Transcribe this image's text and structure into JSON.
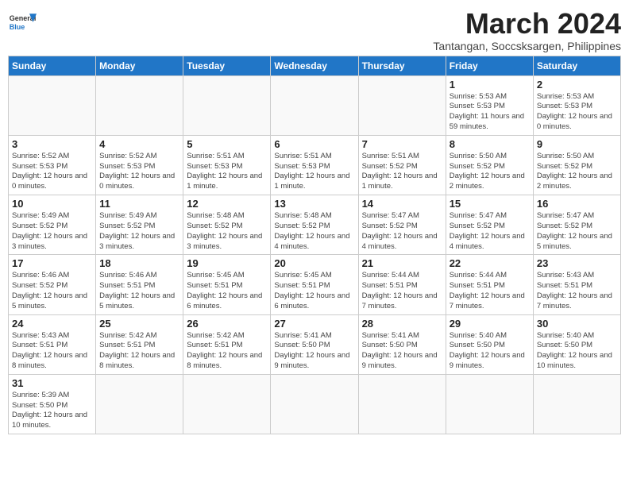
{
  "logo": {
    "general": "General",
    "blue": "Blue"
  },
  "title": "March 2024",
  "subtitle": "Tantangan, Soccsksargen, Philippines",
  "days_of_week": [
    "Sunday",
    "Monday",
    "Tuesday",
    "Wednesday",
    "Thursday",
    "Friday",
    "Saturday"
  ],
  "weeks": [
    [
      {
        "day": "",
        "info": ""
      },
      {
        "day": "",
        "info": ""
      },
      {
        "day": "",
        "info": ""
      },
      {
        "day": "",
        "info": ""
      },
      {
        "day": "",
        "info": ""
      },
      {
        "day": "1",
        "info": "Sunrise: 5:53 AM\nSunset: 5:53 PM\nDaylight: 11 hours and 59 minutes."
      },
      {
        "day": "2",
        "info": "Sunrise: 5:53 AM\nSunset: 5:53 PM\nDaylight: 12 hours and 0 minutes."
      }
    ],
    [
      {
        "day": "3",
        "info": "Sunrise: 5:52 AM\nSunset: 5:53 PM\nDaylight: 12 hours and 0 minutes."
      },
      {
        "day": "4",
        "info": "Sunrise: 5:52 AM\nSunset: 5:53 PM\nDaylight: 12 hours and 0 minutes."
      },
      {
        "day": "5",
        "info": "Sunrise: 5:51 AM\nSunset: 5:53 PM\nDaylight: 12 hours and 1 minute."
      },
      {
        "day": "6",
        "info": "Sunrise: 5:51 AM\nSunset: 5:53 PM\nDaylight: 12 hours and 1 minute."
      },
      {
        "day": "7",
        "info": "Sunrise: 5:51 AM\nSunset: 5:52 PM\nDaylight: 12 hours and 1 minute."
      },
      {
        "day": "8",
        "info": "Sunrise: 5:50 AM\nSunset: 5:52 PM\nDaylight: 12 hours and 2 minutes."
      },
      {
        "day": "9",
        "info": "Sunrise: 5:50 AM\nSunset: 5:52 PM\nDaylight: 12 hours and 2 minutes."
      }
    ],
    [
      {
        "day": "10",
        "info": "Sunrise: 5:49 AM\nSunset: 5:52 PM\nDaylight: 12 hours and 3 minutes."
      },
      {
        "day": "11",
        "info": "Sunrise: 5:49 AM\nSunset: 5:52 PM\nDaylight: 12 hours and 3 minutes."
      },
      {
        "day": "12",
        "info": "Sunrise: 5:48 AM\nSunset: 5:52 PM\nDaylight: 12 hours and 3 minutes."
      },
      {
        "day": "13",
        "info": "Sunrise: 5:48 AM\nSunset: 5:52 PM\nDaylight: 12 hours and 4 minutes."
      },
      {
        "day": "14",
        "info": "Sunrise: 5:47 AM\nSunset: 5:52 PM\nDaylight: 12 hours and 4 minutes."
      },
      {
        "day": "15",
        "info": "Sunrise: 5:47 AM\nSunset: 5:52 PM\nDaylight: 12 hours and 4 minutes."
      },
      {
        "day": "16",
        "info": "Sunrise: 5:47 AM\nSunset: 5:52 PM\nDaylight: 12 hours and 5 minutes."
      }
    ],
    [
      {
        "day": "17",
        "info": "Sunrise: 5:46 AM\nSunset: 5:52 PM\nDaylight: 12 hours and 5 minutes."
      },
      {
        "day": "18",
        "info": "Sunrise: 5:46 AM\nSunset: 5:51 PM\nDaylight: 12 hours and 5 minutes."
      },
      {
        "day": "19",
        "info": "Sunrise: 5:45 AM\nSunset: 5:51 PM\nDaylight: 12 hours and 6 minutes."
      },
      {
        "day": "20",
        "info": "Sunrise: 5:45 AM\nSunset: 5:51 PM\nDaylight: 12 hours and 6 minutes."
      },
      {
        "day": "21",
        "info": "Sunrise: 5:44 AM\nSunset: 5:51 PM\nDaylight: 12 hours and 7 minutes."
      },
      {
        "day": "22",
        "info": "Sunrise: 5:44 AM\nSunset: 5:51 PM\nDaylight: 12 hours and 7 minutes."
      },
      {
        "day": "23",
        "info": "Sunrise: 5:43 AM\nSunset: 5:51 PM\nDaylight: 12 hours and 7 minutes."
      }
    ],
    [
      {
        "day": "24",
        "info": "Sunrise: 5:43 AM\nSunset: 5:51 PM\nDaylight: 12 hours and 8 minutes."
      },
      {
        "day": "25",
        "info": "Sunrise: 5:42 AM\nSunset: 5:51 PM\nDaylight: 12 hours and 8 minutes."
      },
      {
        "day": "26",
        "info": "Sunrise: 5:42 AM\nSunset: 5:51 PM\nDaylight: 12 hours and 8 minutes."
      },
      {
        "day": "27",
        "info": "Sunrise: 5:41 AM\nSunset: 5:50 PM\nDaylight: 12 hours and 9 minutes."
      },
      {
        "day": "28",
        "info": "Sunrise: 5:41 AM\nSunset: 5:50 PM\nDaylight: 12 hours and 9 minutes."
      },
      {
        "day": "29",
        "info": "Sunrise: 5:40 AM\nSunset: 5:50 PM\nDaylight: 12 hours and 9 minutes."
      },
      {
        "day": "30",
        "info": "Sunrise: 5:40 AM\nSunset: 5:50 PM\nDaylight: 12 hours and 10 minutes."
      }
    ],
    [
      {
        "day": "31",
        "info": "Sunrise: 5:39 AM\nSunset: 5:50 PM\nDaylight: 12 hours and 10 minutes."
      },
      {
        "day": "",
        "info": ""
      },
      {
        "day": "",
        "info": ""
      },
      {
        "day": "",
        "info": ""
      },
      {
        "day": "",
        "info": ""
      },
      {
        "day": "",
        "info": ""
      },
      {
        "day": "",
        "info": ""
      }
    ]
  ]
}
